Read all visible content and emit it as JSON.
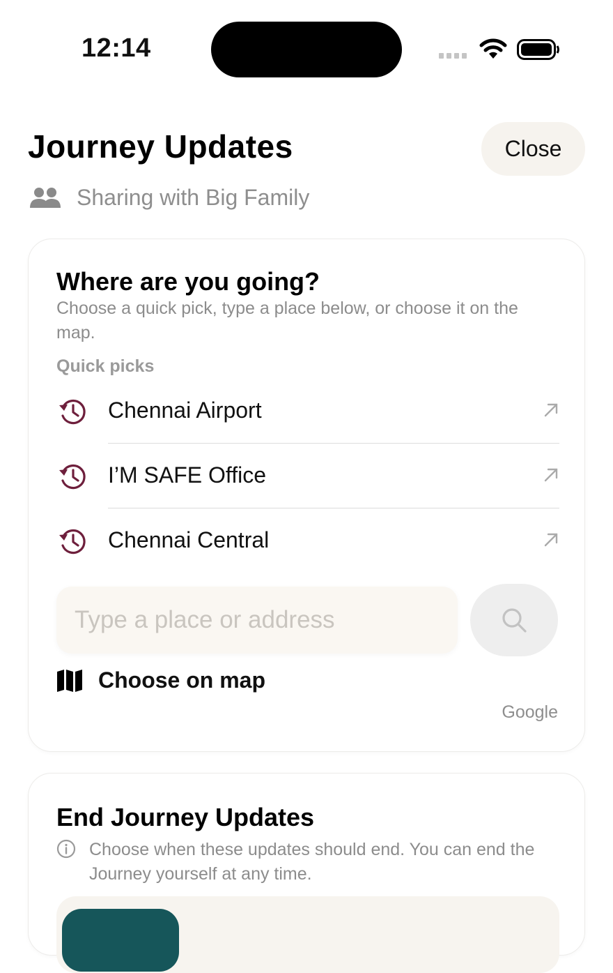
{
  "status_bar": {
    "time": "12:14"
  },
  "header": {
    "title": "Journey Updates",
    "close_label": "Close",
    "sharing_text": "Sharing with Big Family"
  },
  "destination_card": {
    "title": "Where are you going?",
    "subtitle": "Choose a quick pick, type a place below, or choose it on the map.",
    "quick_picks_label": "Quick picks",
    "quick_picks": [
      {
        "label": "Chennai Airport",
        "icon": "history-icon"
      },
      {
        "label": "I’M SAFE Office",
        "icon": "history-icon"
      },
      {
        "label": "Chennai Central",
        "icon": "history-icon"
      }
    ],
    "search_placeholder": "Type a place or address",
    "search_value": "",
    "choose_on_map_label": "Choose on map",
    "attribution": "Google"
  },
  "end_card": {
    "title": "End Journey Updates",
    "info_text": "Choose when these updates should end. You can end the Journey yourself at any time."
  },
  "colors": {
    "accent": "#6e1f3c",
    "teal": "#16565a",
    "muted_text": "#8c8c8c",
    "input_bg": "#faf7f2"
  }
}
